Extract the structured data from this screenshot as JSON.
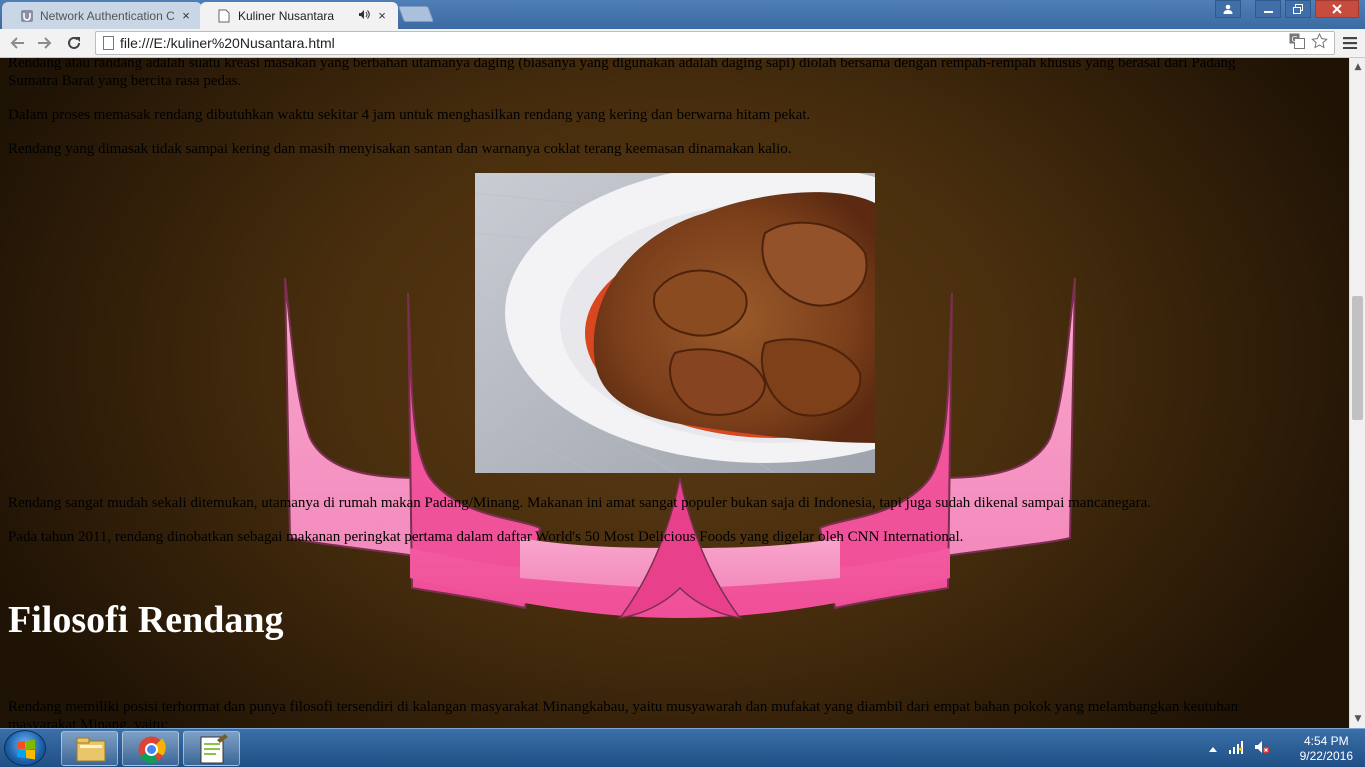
{
  "browser": {
    "tabs": [
      {
        "title": "Network Authentication C",
        "active": false,
        "icon": "university-logo-icon"
      },
      {
        "title": "Kuliner Nusantara",
        "active": true,
        "icon": "page-icon",
        "audio_icon": "speaker-icon"
      }
    ],
    "close_glyph": "×",
    "url": "file:///E:/kuliner%20Nusantara.html"
  },
  "page": {
    "p1_line1": "Rendang atau randang adalah suatu kreasi masakan yang berbahan utamanya daging (biasanya yang digunakan adalah daging sapi) diolah bersama dengan rempah-rempah khusus yang berasal dari Padang",
    "p1_line2": "Sumatra Barat yang bercita rasa pedas.",
    "p2": "Dalam proses memasak rendang dibutuhkan waktu sekitar 4 jam untuk menghasilkan rendang yang kering dan berwarna hitam pekat.",
    "p3": "Rendang yang dimasak tidak sampai kering dan masih menyisakan santan dan warnanya coklat terang keemasan dinamakan kalio.",
    "p4": "Rendang sangat mudah sekali ditemukan, utamanya di rumah makan Padang/Minang. Makanan ini amat sangat populer bukan saja di Indonesia, tapi juga sudah dikenal sampai mancanegara.",
    "p5": "Pada tahun 2011, rendang dinobatkan sebagai makanan peringkat pertama dalam daftar World's 50 Most Delicious Foods yang digelar oleh CNN International.",
    "heading": "Filosofi Rendang",
    "p6_line1": "Rendang memiliki posisi terhormat dan punya filosofi tersendiri di kalangan masyarakat Minangkabau, yaitu musyawarah dan mufakat yang diambil dari empat bahan pokok yang melambangkan keutuhan",
    "p6_line2": "masyarakat Minang, yaitu:"
  },
  "taskbar": {
    "time": "4:54 PM",
    "date": "9/22/2016"
  },
  "colors": {
    "page_bg": "#4a2f0e",
    "roof_pink": "#f06aa8",
    "heading": "#ffffff"
  }
}
